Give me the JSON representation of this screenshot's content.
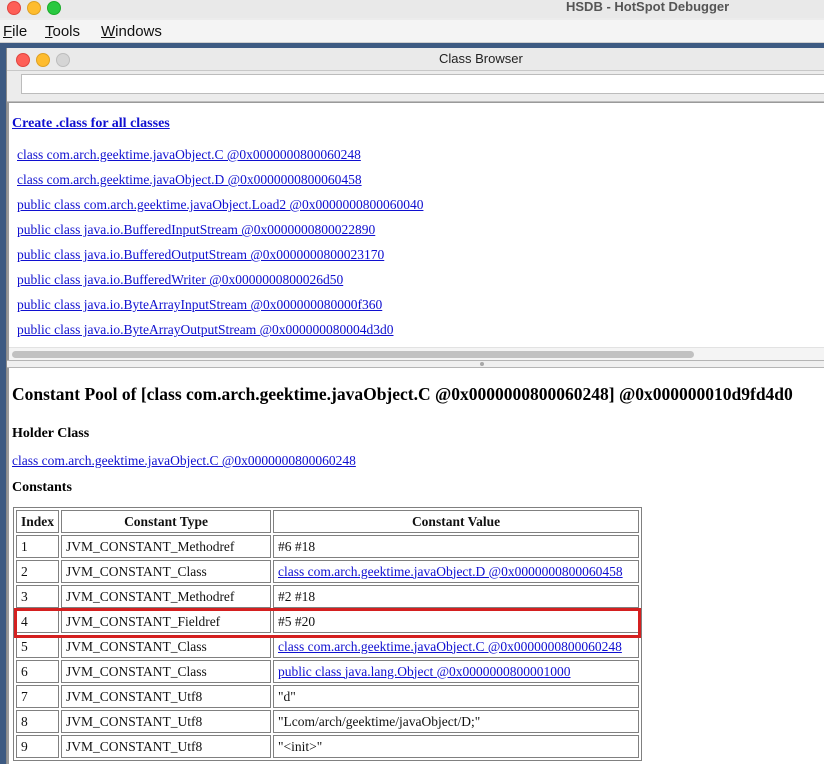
{
  "app": {
    "title": "HSDB - HotSpot Debugger",
    "menu": [
      {
        "first": "F",
        "rest": "ile"
      },
      {
        "first": "T",
        "rest": "ools"
      },
      {
        "first": "W",
        "rest": "indows"
      }
    ]
  },
  "class_browser": {
    "title": "Class Browser",
    "filter": {
      "value": "",
      "placeholder": ""
    },
    "create_link": "Create .class for all classes",
    "classes": [
      "class com.arch.geektime.javaObject.C @0x0000000800060248",
      "class com.arch.geektime.javaObject.D @0x0000000800060458",
      "public class com.arch.geektime.javaObject.Load2 @0x0000000800060040",
      "public class java.io.BufferedInputStream @0x0000000800022890",
      "public class java.io.BufferedOutputStream @0x0000000800023170",
      "public class java.io.BufferedWriter @0x0000000800026d50",
      "public class java.io.ByteArrayInputStream @0x000000080000f360",
      "public class java.io.ByteArrayOutputStream @0x000000080004d3d0"
    ]
  },
  "constant_pool": {
    "title": "Constant Pool of [class com.arch.geektime.javaObject.C @0x0000000800060248] @0x000000010d9fd4d0",
    "holder_heading": "Holder Class",
    "holder_link": "class com.arch.geektime.javaObject.C @0x0000000800060248",
    "constants_heading": "Constants",
    "columns": [
      "Index",
      "Constant Type",
      "Constant Value"
    ],
    "rows": [
      {
        "index": "1",
        "type": "JVM_CONSTANT_Methodref",
        "value": "#6 #18",
        "link": false
      },
      {
        "index": "2",
        "type": "JVM_CONSTANT_Class",
        "value": "class com.arch.geektime.javaObject.D @0x0000000800060458",
        "link": true
      },
      {
        "index": "3",
        "type": "JVM_CONSTANT_Methodref",
        "value": "#2 #18",
        "link": false
      },
      {
        "index": "4",
        "type": "JVM_CONSTANT_Fieldref",
        "value": "#5 #20",
        "link": false
      },
      {
        "index": "5",
        "type": "JVM_CONSTANT_Class",
        "value": "class com.arch.geektime.javaObject.C @0x0000000800060248",
        "link": true
      },
      {
        "index": "6",
        "type": "JVM_CONSTANT_Class",
        "value": "public class java.lang.Object @0x0000000800001000",
        "link": true
      },
      {
        "index": "7",
        "type": "JVM_CONSTANT_Utf8",
        "value": "\"d\"",
        "link": false
      },
      {
        "index": "8",
        "type": "JVM_CONSTANT_Utf8",
        "value": "\"Lcom/arch/geektime/javaObject/D;\"",
        "link": false
      },
      {
        "index": "9",
        "type": "JVM_CONSTANT_Utf8",
        "value": "\"<init>\"",
        "link": false
      }
    ],
    "highlighted_row": "2"
  },
  "colors": {
    "link": "#1010d0",
    "highlight": "#d42020",
    "desktop": "#3d5a82"
  }
}
